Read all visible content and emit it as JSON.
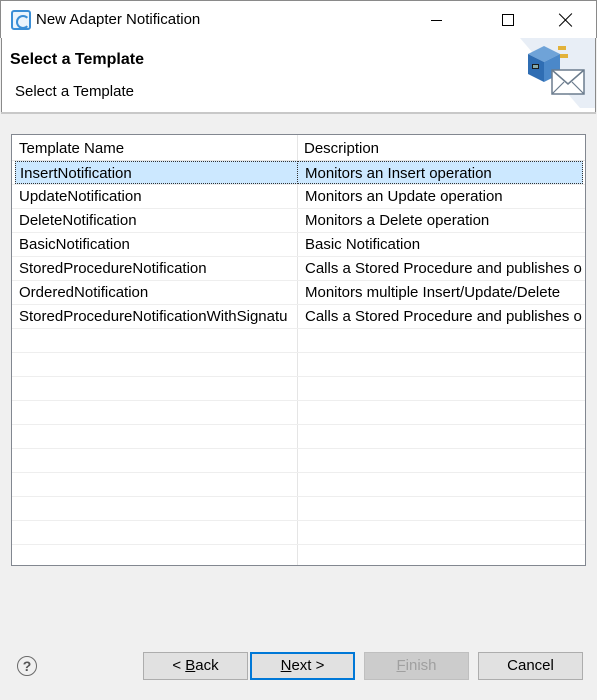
{
  "window": {
    "title": "New Adapter Notification",
    "icon": "eclipse-app-icon"
  },
  "banner": {
    "title": "Select a Template",
    "subtitle": "Select a Template",
    "icon": "adapter-notification-icon"
  },
  "table": {
    "columns": [
      "Template Name",
      "Description"
    ],
    "rows": [
      {
        "name": "InsertNotification",
        "description": "Monitors an Insert operation",
        "selected": true
      },
      {
        "name": "UpdateNotification",
        "description": "Monitors an Update operation"
      },
      {
        "name": "DeleteNotification",
        "description": "Monitors a Delete operation"
      },
      {
        "name": "BasicNotification",
        "description": "Basic Notification"
      },
      {
        "name": "StoredProcedureNotification",
        "description": "Calls a Stored Procedure and publishes o"
      },
      {
        "name": "OrderedNotification",
        "description": "Monitors multiple Insert/Update/Delete"
      },
      {
        "name": "StoredProcedureNotificationWithSignatu",
        "description": "Calls a Stored Procedure and publishes o"
      }
    ],
    "empty_rows": 10,
    "selection_color": "#cce8ff"
  },
  "buttons": {
    "help": "?",
    "back_prefix": "< ",
    "back_mnemonic": "B",
    "back_rest": "ack",
    "next_mnemonic": "N",
    "next_rest": "ext >",
    "finish_mnemonic": "F",
    "finish_rest": "inish",
    "cancel": "Cancel"
  }
}
